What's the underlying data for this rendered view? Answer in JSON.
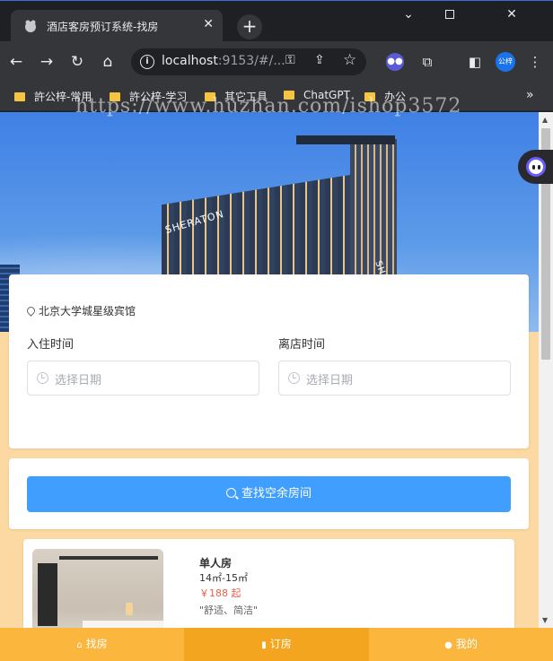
{
  "browser": {
    "tab_title": "酒店客房预订系统-找房",
    "url_host": "localhost",
    "url_rest": ":9153/#/...",
    "profile_label": "公梓",
    "bookmarks": [
      "許公梓-常用",
      "許公梓-学习",
      "其它工具",
      "ChatGPT",
      "办公"
    ],
    "watermark": "https://www.huzhan.com/ishop3572"
  },
  "hero": {
    "sign_text": "SHERATON"
  },
  "search": {
    "location": "北京大学城星级宾馆",
    "checkin_label": "入住时间",
    "checkout_label": "离店时间",
    "checkin_placeholder": "选择日期",
    "checkout_placeholder": "选择日期",
    "button_label": "查找空余房间"
  },
  "room": {
    "name": "单人房",
    "size": "14㎡-15㎡",
    "price": "￥188 起",
    "description": "\"舒适、简洁\""
  },
  "bottom_nav": {
    "find": "找房",
    "order": "订房",
    "mine": "我的"
  },
  "colors": {
    "primary": "#409eff",
    "nav_bg": "#fbb63e",
    "page_bg": "#fcd9a2",
    "price": "#e8634c"
  }
}
